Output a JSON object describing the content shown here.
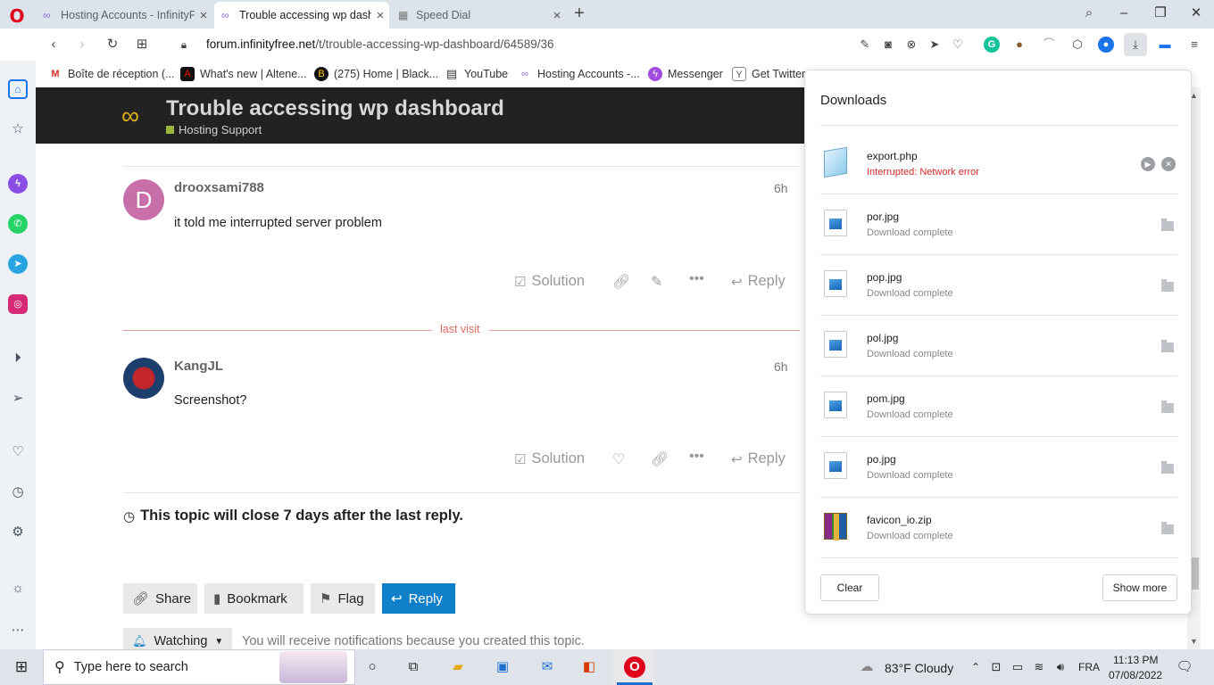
{
  "tabs": [
    {
      "title": "Hosting Accounts - InfinityFree",
      "active": false
    },
    {
      "title": "Trouble accessing wp dashboard",
      "active": true
    },
    {
      "title": "Speed Dial",
      "active": false
    }
  ],
  "address": {
    "domain": "forum.infinityfree.net",
    "path": "/t/trouble-accessing-wp-dashboard/64589/36"
  },
  "bookmarks": [
    {
      "label": "Boîte de réception (...",
      "icon": "gmail-icon"
    },
    {
      "label": "What's new | Altene...",
      "icon": "altenen-icon"
    },
    {
      "label": "(275) Home | Black...",
      "icon": "blackhat-icon"
    },
    {
      "label": "YouTube",
      "icon": "page-icon"
    },
    {
      "label": "Hosting Accounts -...",
      "icon": "infinity-icon"
    },
    {
      "label": "Messenger",
      "icon": "messenger-icon"
    },
    {
      "label": "Get Twitter",
      "icon": "y-icon"
    }
  ],
  "topic": {
    "title": "Trouble accessing wp dashboard",
    "category": "Hosting Support"
  },
  "posts": [
    {
      "avatar_letter": "D",
      "username": "drooxsami788",
      "age": "6h",
      "body": "it told me interrupted server problem",
      "actions": {
        "solution": "Solution",
        "reply": "Reply"
      }
    },
    {
      "avatar_letter": "",
      "username": "KangJL",
      "age": "6h",
      "body": "Screenshot?",
      "actions": {
        "solution": "Solution",
        "reply": "Reply"
      }
    }
  ],
  "last_visit_label": "last visit",
  "close_note": "This topic will close 7 days after the last reply.",
  "footer_buttons": {
    "share": "Share",
    "bookmark": "Bookmark",
    "flag": "Flag",
    "reply": "Reply"
  },
  "watching": {
    "label": "Watching",
    "note": "You will receive notifications because you created this topic."
  },
  "downloads": {
    "title": "Downloads",
    "items": [
      {
        "name": "export.php",
        "status": "Interrupted: Network error",
        "type": "php"
      },
      {
        "name": "por.jpg",
        "status": "Download complete",
        "type": "img"
      },
      {
        "name": "pop.jpg",
        "status": "Download complete",
        "type": "img"
      },
      {
        "name": "pol.jpg",
        "status": "Download complete",
        "type": "img"
      },
      {
        "name": "pom.jpg",
        "status": "Download complete",
        "type": "img"
      },
      {
        "name": "po.jpg",
        "status": "Download complete",
        "type": "img"
      },
      {
        "name": "favicon_io.zip",
        "status": "Download complete",
        "type": "zip"
      }
    ],
    "clear": "Clear",
    "show_more": "Show more"
  },
  "taskbar": {
    "search_placeholder": "Type here to search",
    "weather": "83°F  Cloudy",
    "language": "FRA",
    "time": "11:13 PM",
    "date": "07/08/2022"
  },
  "colors": {
    "accent": "#0f80c9",
    "error": "#d72a2a",
    "header_bg": "#222222",
    "last_visit": "#e06b5f"
  }
}
